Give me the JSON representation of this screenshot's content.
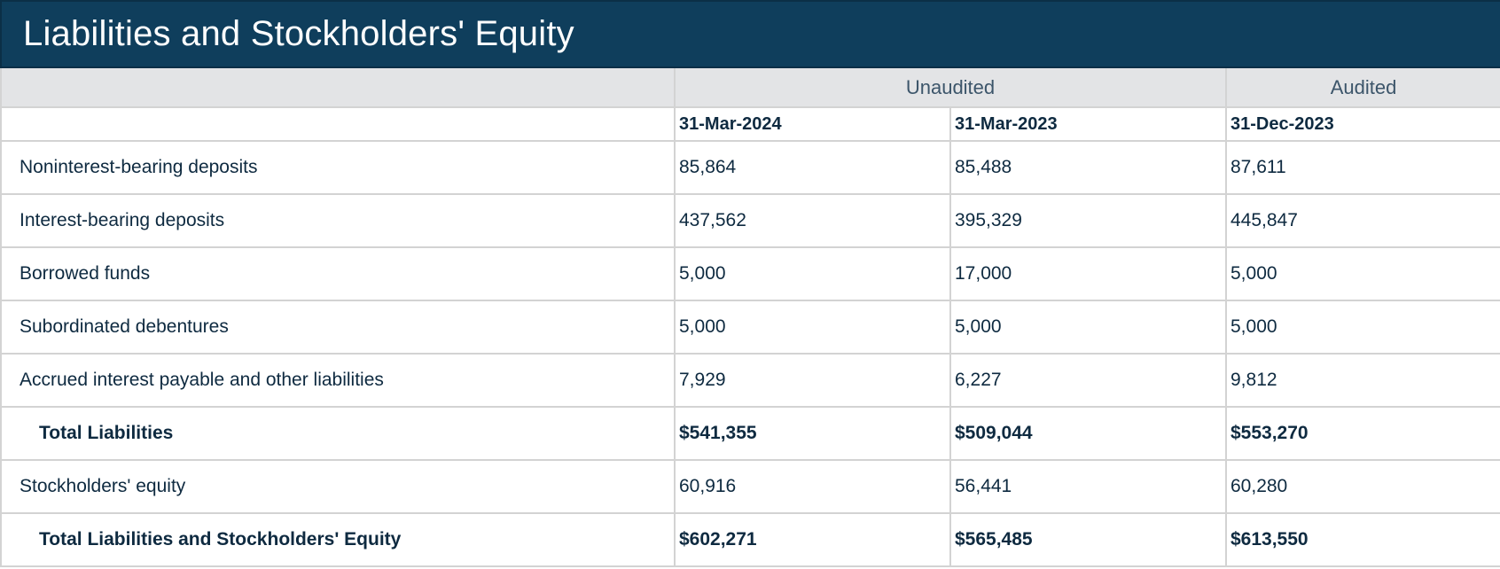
{
  "title": "Liabilities and Stockholders' Equity",
  "column_groups": {
    "unaudited": "Unaudited",
    "audited": "Audited"
  },
  "columns": [
    "31-Mar-2024",
    "31-Mar-2023",
    "31-Dec-2023"
  ],
  "rows": [
    {
      "label": "Noninterest-bearing deposits",
      "values": [
        "85,864",
        "85,488",
        "87,611"
      ],
      "total": false
    },
    {
      "label": "Interest-bearing deposits",
      "values": [
        "437,562",
        "395,329",
        "445,847"
      ],
      "total": false
    },
    {
      "label": "Borrowed funds",
      "values": [
        "5,000",
        "17,000",
        "5,000"
      ],
      "total": false
    },
    {
      "label": "Subordinated debentures",
      "values": [
        "5,000",
        "5,000",
        "5,000"
      ],
      "total": false
    },
    {
      "label": "Accrued interest payable and other liabilities",
      "values": [
        "7,929",
        "6,227",
        "9,812"
      ],
      "total": false
    },
    {
      "label": "Total Liabilities",
      "values": [
        "$541,355",
        "$509,044",
        "$553,270"
      ],
      "total": true
    },
    {
      "label": "Stockholders' equity",
      "values": [
        "60,916",
        "56,441",
        "60,280"
      ],
      "total": false
    },
    {
      "label": "Total Liabilities and Stockholders' Equity",
      "values": [
        "$602,271",
        "$565,485",
        "$613,550"
      ],
      "total": true
    }
  ],
  "colors": {
    "header_bg": "#0f3e5c",
    "group_bg": "#e3e4e6",
    "text": "#0e2a40",
    "border": "#d3d3d3"
  }
}
